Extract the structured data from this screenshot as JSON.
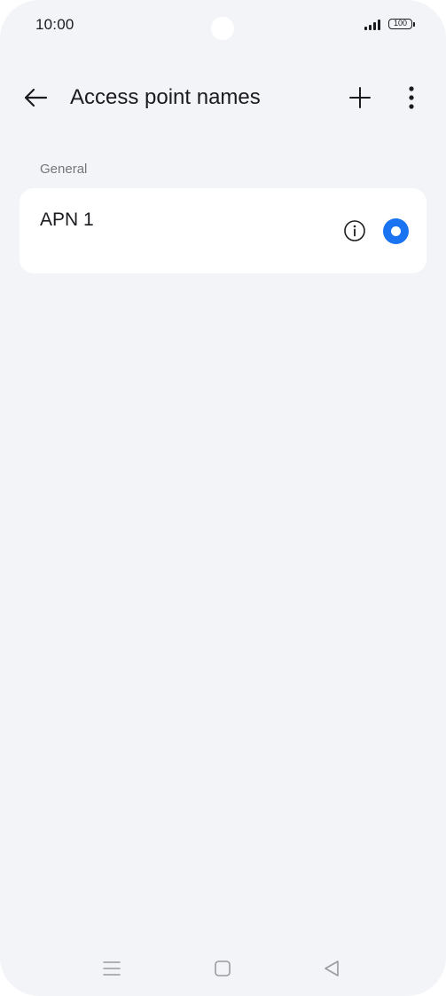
{
  "status_bar": {
    "time": "10:00",
    "battery_level": "100",
    "signal_icon": "signal-bars-icon",
    "battery_icon": "battery-icon"
  },
  "header": {
    "title": "Access point names",
    "back_icon": "arrow-left-icon",
    "add_icon": "plus-icon",
    "menu_icon": "more-vertical-icon"
  },
  "section": {
    "label": "General",
    "items": [
      {
        "name": "APN 1",
        "selected": true,
        "info_icon": "info-icon"
      }
    ]
  },
  "nav_bar": {
    "recents_icon": "menu-lines-icon",
    "home_icon": "square-icon",
    "back_icon": "triangle-back-icon"
  },
  "colors": {
    "background": "#f3f4f7",
    "card": "#ffffff",
    "accent": "#1a73f0",
    "text": "#1b1b1f",
    "secondary_text": "#75757a"
  }
}
